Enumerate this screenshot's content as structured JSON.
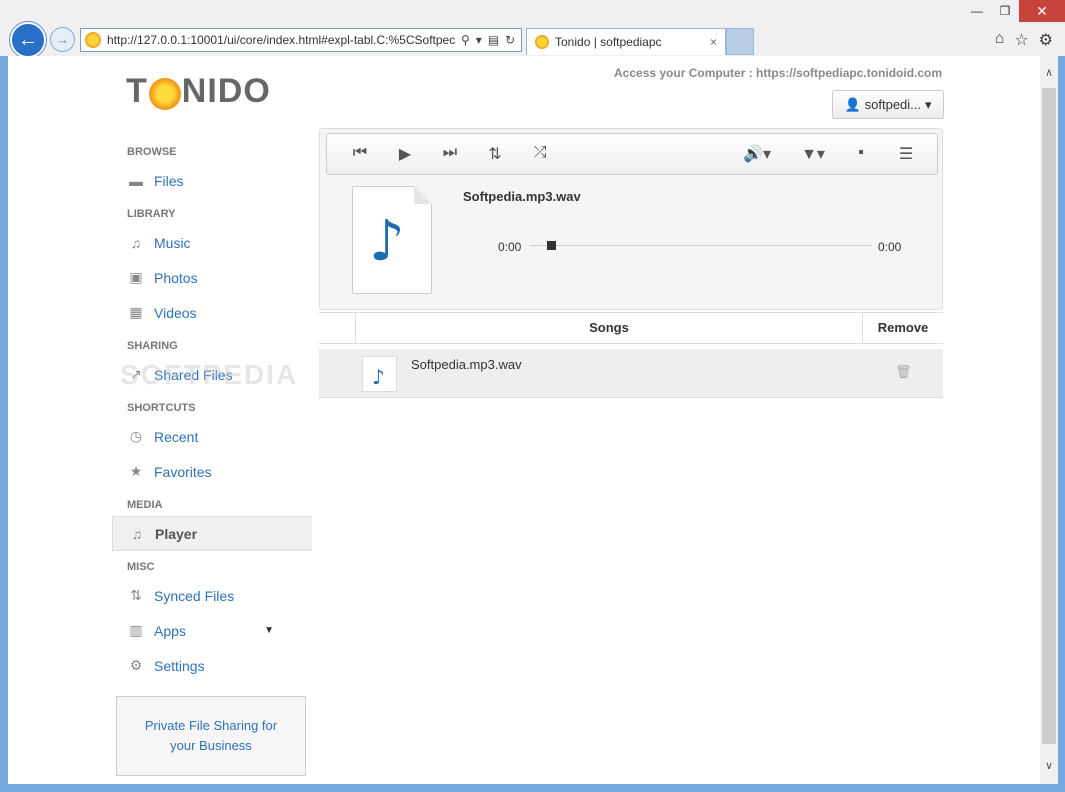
{
  "browser": {
    "url": "http://127.0.0.1:10001/ui/core/index.html#expl-tabl.C:%5CSoftpec",
    "tab_title": "Tonido | softpediapc",
    "tab_close": "×",
    "minimize": "—",
    "maximize": "❐",
    "close": "✕"
  },
  "header": {
    "logo_left": "T",
    "logo_right": "NIDO",
    "access_text": "Access your Computer : https://softpediapc.tonidoid.com",
    "user_label": "softpedi..."
  },
  "sidebar": {
    "sections": {
      "browse": "BROWSE",
      "library": "LIBRARY",
      "sharing": "SHARING",
      "shortcuts": "SHORTCUTS",
      "media": "MEDIA",
      "misc": "MISC"
    },
    "items": {
      "files": "Files",
      "music": "Music",
      "photos": "Photos",
      "videos": "Videos",
      "shared_files": "Shared Files",
      "recent": "Recent",
      "favorites": "Favorites",
      "player": "Player",
      "synced_files": "Synced Files",
      "apps": "Apps",
      "settings": "Settings"
    },
    "promo_line1": "Private File Sharing for",
    "promo_line2": "your Business"
  },
  "player": {
    "track_title": "Softpedia.mp3.wav",
    "time_start": "0:00",
    "time_end": "0:00",
    "progress": 0.05
  },
  "songs": {
    "header_songs": "Songs",
    "header_remove": "Remove",
    "rows": [
      {
        "name": "Softpedia.mp3.wav"
      }
    ]
  },
  "watermark": "SOFTPEDIA"
}
